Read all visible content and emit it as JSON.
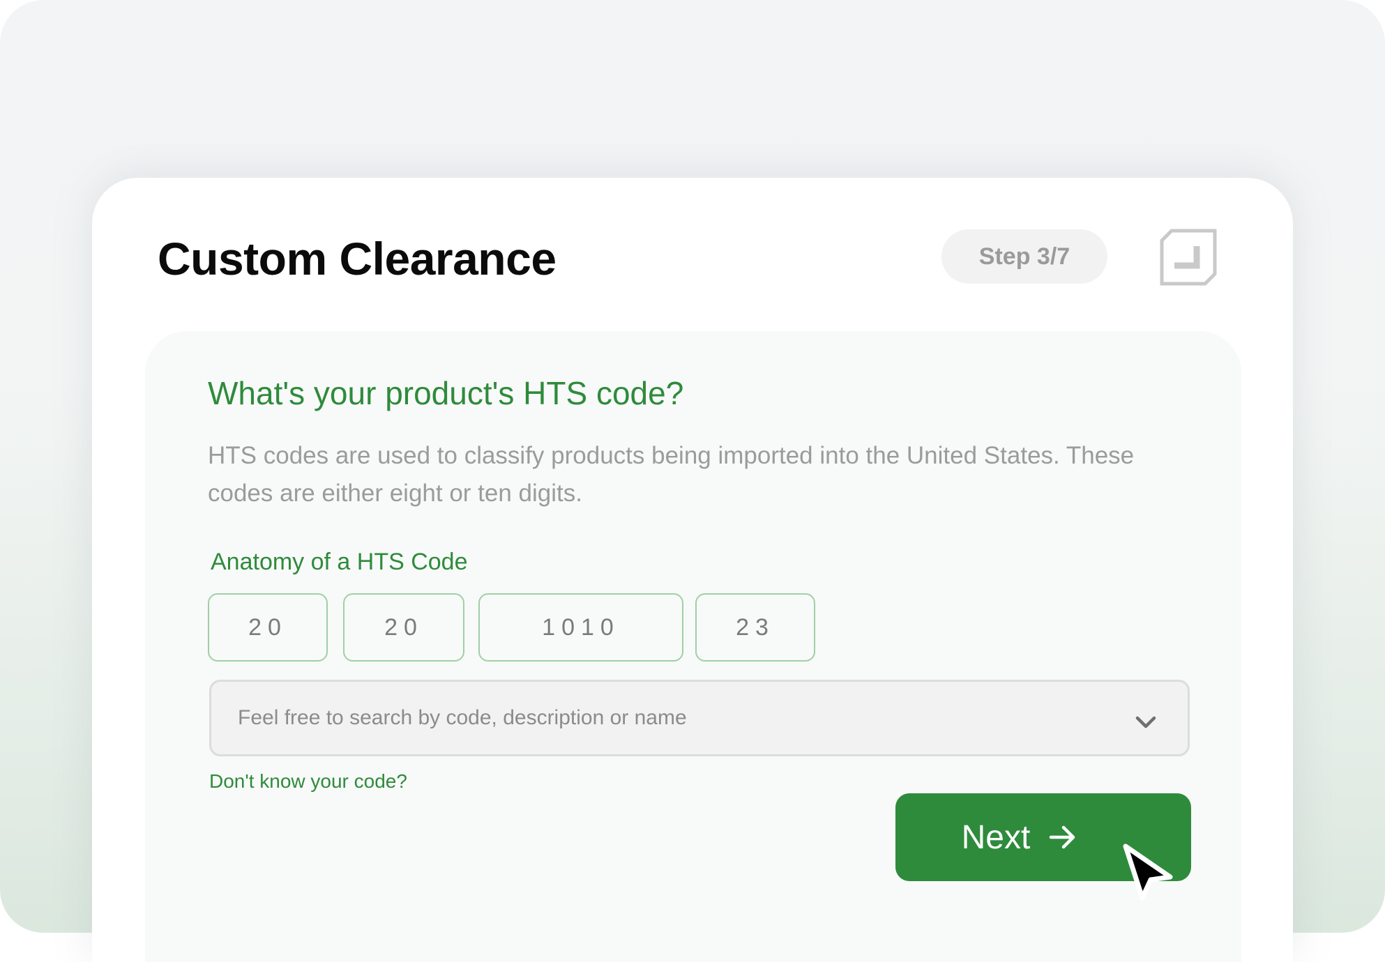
{
  "header": {
    "title": "Custom Clearance",
    "step_label": "Step 3/7",
    "corner_icon": "expand-corner-icon"
  },
  "question": {
    "title": "What's your product's HTS code?",
    "description": "HTS codes are used to classify products being imported into the United States. These codes are either eight or ten digits."
  },
  "anatomy": {
    "label": "Anatomy of a HTS Code",
    "segments": [
      "20",
      "20",
      "1010",
      "23"
    ]
  },
  "search": {
    "placeholder": "Feel free to search by code, description or name",
    "icon": "chevron-down-icon"
  },
  "help_link": "Don't know your code?",
  "next_button": {
    "label": "Next",
    "icon": "arrow-right-icon"
  },
  "colors": {
    "accent": "#2e8b3b",
    "segment_border": "#9fd0a5",
    "muted_text": "#9b9b9b"
  }
}
